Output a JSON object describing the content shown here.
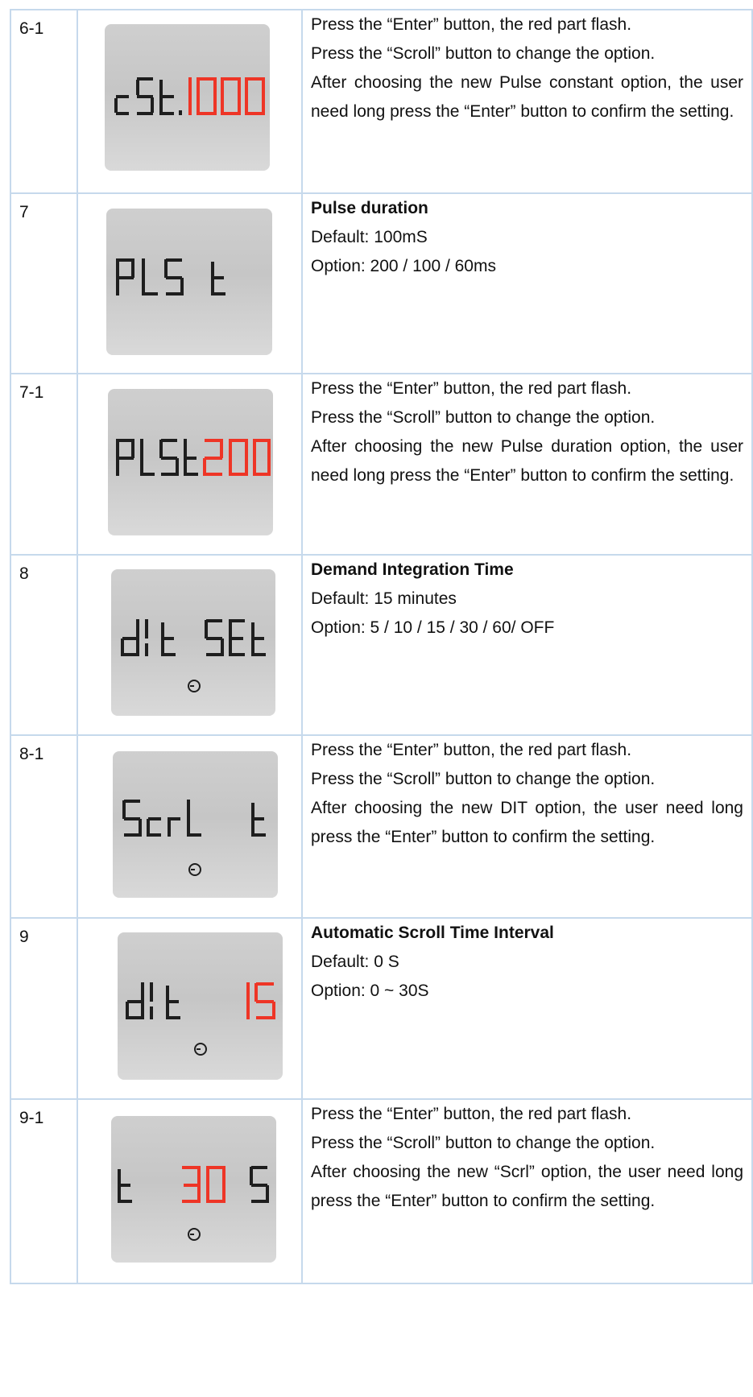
{
  "colors": {
    "border": "#c6d9ec",
    "lcd_digit": "#1e1e1e",
    "lcd_highlight": "#ee3526"
  },
  "rows": [
    {
      "step": "6-1",
      "display": {
        "black": "cSt.",
        "red": "1000",
        "clock": false
      },
      "paragraphs": [
        "Press the “Enter” button, the red part flash.",
        "Press the “Scroll” button to change the option.",
        "After choosing the new Pulse constant option, the user need long press the “Enter” button to confirm the setting."
      ]
    },
    {
      "step": "7",
      "display": {
        "black": "PLS t",
        "red": "",
        "clock": false
      },
      "title": "Pulse duration",
      "paragraphs": [
        "Default: 100mS",
        "Option: 200 / 100 / 60ms"
      ]
    },
    {
      "step": "7-1",
      "display": {
        "black": "PLSt",
        "red": "200",
        "clock": false
      },
      "paragraphs": [
        "Press the “Enter” button, the red part flash.",
        "Press the “Scroll” button to change the option.",
        "After choosing the new Pulse duration option, the user need long press the “Enter” button to confirm the setting."
      ]
    },
    {
      "step": "8",
      "display": {
        "black": "dIt SEt",
        "red": "",
        "clock": true
      },
      "title": "Demand Integration Time",
      "paragraphs": [
        "Default: 15 minutes",
        "Option: 5 / 10 / 15 / 30 / 60/ OFF"
      ]
    },
    {
      "step": "8-1",
      "display": {
        "black": "ScrL t",
        "red": "",
        "clock": true
      },
      "paragraphs": [
        "Press the “Enter” button, the red part flash.",
        "Press the “Scroll” button to change the option.",
        "After choosing the new DIT option, the user need long press the “Enter” button to confirm the setting."
      ]
    },
    {
      "step": "9",
      "display": {
        "black": "dIt",
        "red": "15",
        "clock": true
      },
      "title": "Automatic Scroll Time Interval",
      "paragraphs": [
        "Default: 0 S",
        "Option: 0 ~ 30S"
      ]
    },
    {
      "step": "9-1",
      "display": {
        "black": "t S",
        "red": "30",
        "clock": true
      },
      "paragraphs": [
        "Press the “Enter” button, the red part flash.",
        "Press the “Scroll” button to change the option.",
        "After choosing the new “Scrl” option, the user need long press the “Enter” button to confirm the setting."
      ]
    }
  ]
}
